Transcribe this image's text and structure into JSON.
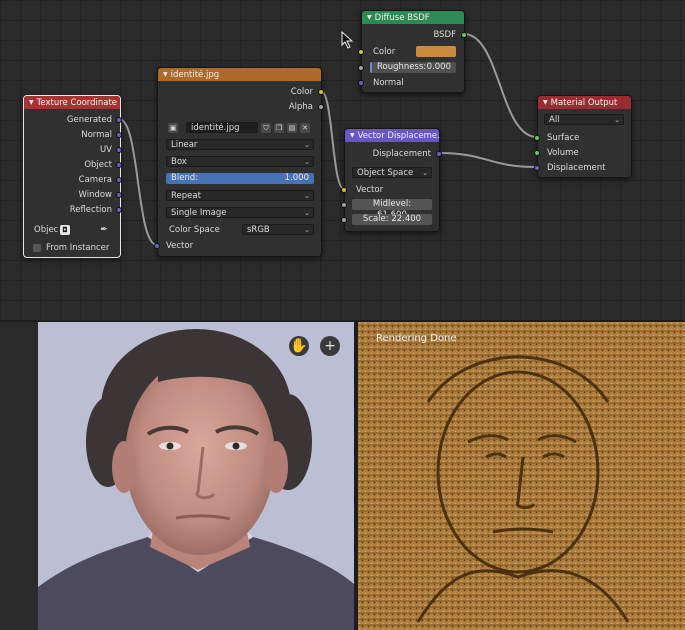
{
  "cursor_icon": "pointer-arrow-icon",
  "texture_coordinate": {
    "title": "Texture Coordinate",
    "outputs": [
      "Generated",
      "Normal",
      "UV",
      "Object",
      "Camera",
      "Window",
      "Reflection"
    ],
    "object_label": "Objec",
    "from_instancer": "From Instancer"
  },
  "image_texture": {
    "title": "identité.jpg",
    "outputs": [
      "Color",
      "Alpha"
    ],
    "image_name": "identité.jpg",
    "interpolation": "Linear",
    "projection": "Box",
    "blend_label": "Blend:",
    "blend_value": "1.000",
    "extension": "Repeat",
    "source": "Single Image",
    "color_space_label": "Color Space",
    "color_space": "sRGB",
    "input_vector": "Vector"
  },
  "diffuse_bsdf": {
    "title": "Diffuse BSDF",
    "output": "BSDF",
    "color_label": "Color",
    "color_swatch": "#c88a3e",
    "roughness_label": "Roughness:",
    "roughness_value": "0.000",
    "normal_label": "Normal"
  },
  "vector_displacement": {
    "title": "Vector Displaceme..",
    "output": "Displacement",
    "space": "Object Space",
    "input_vector": "Vector",
    "midlevel_label": "Midlevel:",
    "midlevel_value": "61.600",
    "scale_label": "Scale:",
    "scale_value": "22.400"
  },
  "material_output": {
    "title": "Material Output",
    "target": "All",
    "inputs": [
      "Surface",
      "Volume",
      "Displacement"
    ]
  },
  "viewport": {
    "render_status": "Rendering Done",
    "hand_icon": "hand-pan-icon",
    "zoom_icon": "zoom-in-icon"
  },
  "colors": {
    "texture_header": "#a83232",
    "image_header": "#ad6a2a",
    "shader_header": "#2d8a55",
    "vector_header": "#6a56c2",
    "output_header": "#9b2b33",
    "render_tint": "#b08040"
  }
}
